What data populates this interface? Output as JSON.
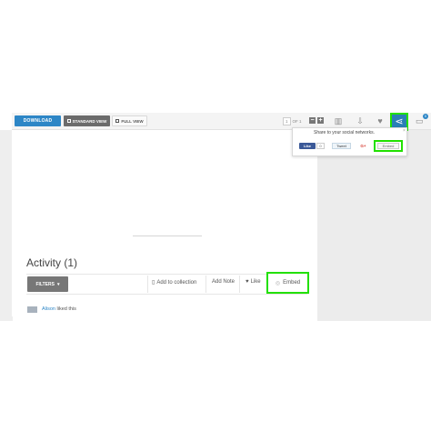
{
  "toolbar": {
    "download_label": "DOWNLOAD",
    "standard_view_label": "STANDARD VIEW",
    "full_view_label": "FULL VIEW",
    "pager": {
      "current": "1",
      "of_label": "OF 1"
    },
    "zoom_out": "−",
    "zoom_in": "+"
  },
  "share_popup": {
    "title": "Share to your social networks.",
    "close": "×",
    "facebook_label": "Like",
    "facebook_count": "0",
    "twitter_label": "Tweet",
    "google_label": "G+",
    "embed_label": "Embed"
  },
  "comments": {
    "badge_count": "0"
  },
  "activity": {
    "heading": "Activity (1)",
    "filters_label": "FILTERS",
    "actions": {
      "add_to_collection": "Add to collection",
      "add_note": "Add Note",
      "like": "Like",
      "embed": "Embed"
    },
    "items": [
      {
        "user": "Alison",
        "text": "liked this"
      }
    ]
  },
  "colors": {
    "accent_blue": "#2d86c6",
    "highlight_green": "#22e000",
    "facebook_blue": "#3b5998"
  }
}
